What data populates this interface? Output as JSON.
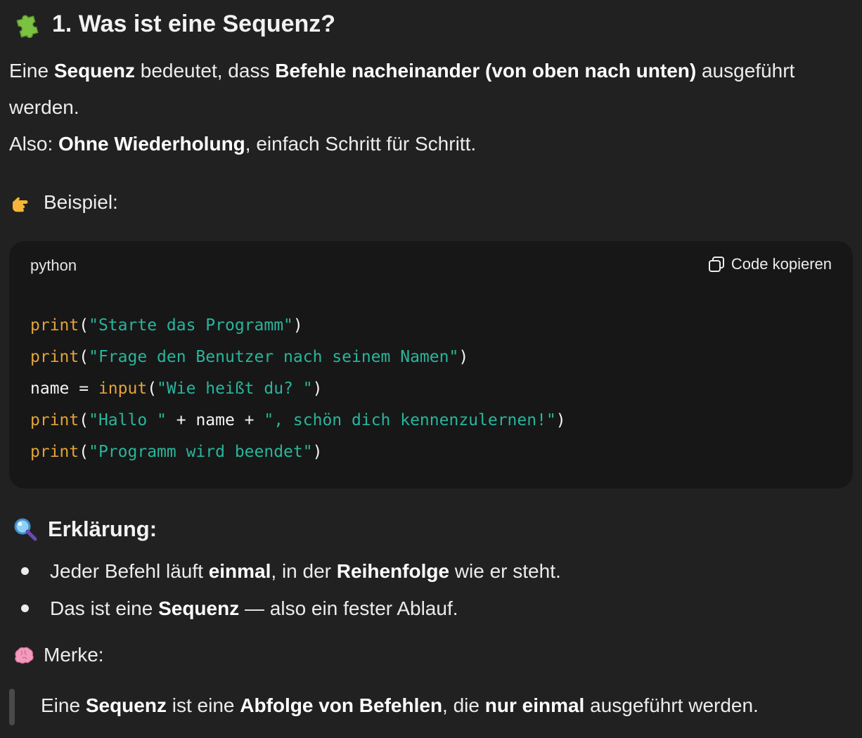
{
  "heading": {
    "icon": "puzzle-piece-icon",
    "title": "1. Was ist eine Sequenz?"
  },
  "intro": {
    "line1": [
      {
        "t": "Eine ",
        "b": false
      },
      {
        "t": "Sequenz",
        "b": true
      },
      {
        "t": " bedeutet, dass ",
        "b": false
      },
      {
        "t": "Befehle nacheinander (von oben nach unten)",
        "b": true
      },
      {
        "t": " ausgeführt werden.",
        "b": false
      }
    ],
    "line2": [
      {
        "t": "Also: ",
        "b": false
      },
      {
        "t": "Ohne Wiederholung",
        "b": true
      },
      {
        "t": ", einfach Schritt für Schritt.",
        "b": false
      }
    ]
  },
  "example": {
    "icon": "pointing-hand-icon",
    "label": "Beispiel:"
  },
  "code_block": {
    "language": "python",
    "copy_label": "Code kopieren",
    "copy_icon": "copy-icon",
    "lines": [
      [
        {
          "k": "fn",
          "t": "print"
        },
        {
          "k": "pn",
          "t": "("
        },
        {
          "k": "str",
          "t": "\"Starte das Programm\""
        },
        {
          "k": "pn",
          "t": ")"
        }
      ],
      [
        {
          "k": "fn",
          "t": "print"
        },
        {
          "k": "pn",
          "t": "("
        },
        {
          "k": "str",
          "t": "\"Frage den Benutzer nach seinem Namen\""
        },
        {
          "k": "pn",
          "t": ")"
        }
      ],
      [
        {
          "k": "id",
          "t": "name"
        },
        {
          "k": "pn",
          "t": " = "
        },
        {
          "k": "fn",
          "t": "input"
        },
        {
          "k": "pn",
          "t": "("
        },
        {
          "k": "str",
          "t": "\"Wie heißt du? \""
        },
        {
          "k": "pn",
          "t": ")"
        }
      ],
      [
        {
          "k": "fn",
          "t": "print"
        },
        {
          "k": "pn",
          "t": "("
        },
        {
          "k": "str",
          "t": "\"Hallo \""
        },
        {
          "k": "pn",
          "t": " + "
        },
        {
          "k": "id",
          "t": "name"
        },
        {
          "k": "pn",
          "t": " + "
        },
        {
          "k": "str",
          "t": "\", schön dich kennenzulernen!\""
        },
        {
          "k": "pn",
          "t": ")"
        }
      ],
      [
        {
          "k": "fn",
          "t": "print"
        },
        {
          "k": "pn",
          "t": "("
        },
        {
          "k": "str",
          "t": "\"Programm wird beendet\""
        },
        {
          "k": "pn",
          "t": ")"
        }
      ]
    ]
  },
  "explanation": {
    "icon": "magnifying-glass-icon",
    "title": "Erklärung:",
    "bullets": [
      [
        {
          "t": "Jeder Befehl läuft ",
          "b": false
        },
        {
          "t": "einmal",
          "b": true
        },
        {
          "t": ", in der ",
          "b": false
        },
        {
          "t": "Reihenfolge",
          "b": true
        },
        {
          "t": " wie er steht.",
          "b": false
        }
      ],
      [
        {
          "t": "Das ist eine ",
          "b": false
        },
        {
          "t": "Sequenz",
          "b": true
        },
        {
          "t": " — also ein fester Ablauf.",
          "b": false
        }
      ]
    ]
  },
  "remember": {
    "icon": "brain-icon",
    "label": "Merke:",
    "quote": [
      {
        "t": "Eine ",
        "b": false
      },
      {
        "t": "Sequenz",
        "b": true
      },
      {
        "t": " ist eine ",
        "b": false
      },
      {
        "t": "Abfolge von Befehlen",
        "b": true
      },
      {
        "t": ", die ",
        "b": false
      },
      {
        "t": "nur einmal",
        "b": true
      },
      {
        "t": " ausgeführt werden.",
        "b": false
      }
    ]
  }
}
